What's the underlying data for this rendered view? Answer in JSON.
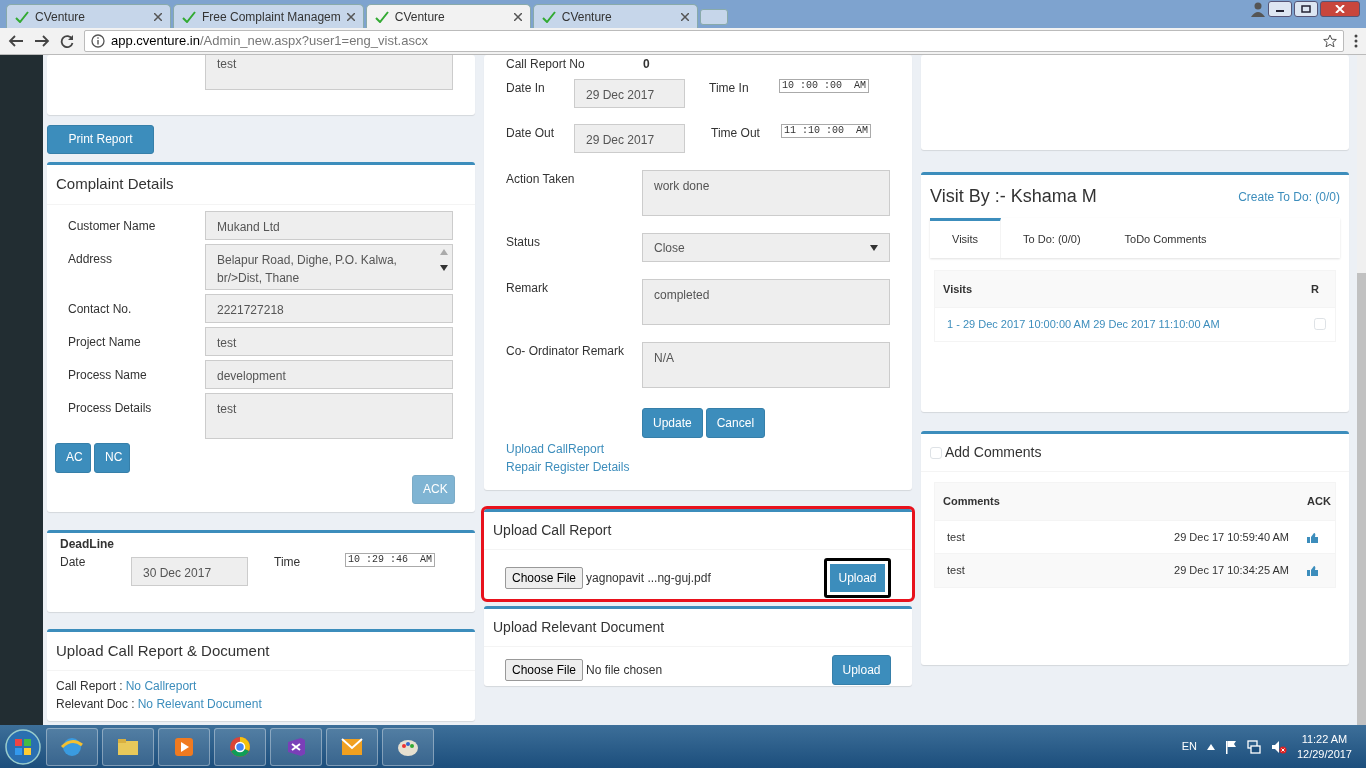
{
  "browser": {
    "tabs": [
      {
        "title": "CVenture",
        "selected": false
      },
      {
        "title": "Free Complaint Managem",
        "selected": false
      },
      {
        "title": "CVenture",
        "selected": true
      },
      {
        "title": "CVenture",
        "selected": false
      }
    ],
    "url_host": "app.cventure.in",
    "url_path": "/Admin_new.aspx?user1=eng_vist.ascx"
  },
  "left": {
    "top_card": {
      "value": "test"
    },
    "print_button": "Print Report",
    "complaint": {
      "title": "Complaint Details",
      "fields": [
        {
          "label": "Customer Name",
          "value": "Mukand Ltd",
          "kind": "input"
        },
        {
          "label": "Address",
          "value": "Belapur Road, Dighe, P.O. Kalwa,\nbr/>Dist, Thane",
          "kind": "scroll"
        },
        {
          "label": "Contact No.",
          "value": "2221727218",
          "kind": "input"
        },
        {
          "label": "Project Name",
          "value": "test",
          "kind": "input"
        },
        {
          "label": "Process Name",
          "value": "development",
          "kind": "input"
        },
        {
          "label": "Process Details",
          "value": "test",
          "kind": "textarea"
        }
      ],
      "buttons": [
        "AC",
        "NC"
      ],
      "ack": {
        "label": "ACK",
        "disabled": true
      }
    },
    "deadline": {
      "title": "DeadLine",
      "date_label": "Date",
      "date": "30 Dec 2017",
      "time_label": "Time",
      "time": "10 :29 :46  AM"
    },
    "upload_summary": {
      "title": "Upload Call Report & Document",
      "rows": [
        {
          "label": "Call Report :",
          "link": "No Callreport"
        },
        {
          "label": "Relevant Doc :",
          "link": "No Relevant Document"
        }
      ]
    }
  },
  "middle": {
    "call_report_no": {
      "label": "Call Report No",
      "value": "0"
    },
    "date_in": {
      "label": "Date In",
      "value": "29 Dec 2017",
      "time_label": "Time In",
      "time": "10 :00 :00  AM"
    },
    "date_out": {
      "label": "Date Out",
      "value": "29 Dec 2017",
      "time_label": "Time Out",
      "time": "11 :10 :00  AM"
    },
    "fields": [
      {
        "label": "Action Taken",
        "value": "work done",
        "kind": "textarea"
      },
      {
        "label": "Status",
        "value": "Close",
        "kind": "select"
      },
      {
        "label": "Remark",
        "value": "completed",
        "kind": "textarea"
      },
      {
        "label": "Co- Ordinator Remark",
        "value": "N/A",
        "kind": "textarea"
      }
    ],
    "buttons": [
      "Update",
      "Cancel"
    ],
    "links": [
      "Upload CallReport",
      "Repair Register Details"
    ],
    "uploads": [
      {
        "title": "Upload Call Report",
        "highlighted": true,
        "choose": "Choose File",
        "file": "yagnopavit ...ng-guj.pdf",
        "upload": "Upload",
        "upload_highlighted": true
      },
      {
        "title": "Upload Relevant Document",
        "highlighted": false,
        "choose": "Choose File",
        "file": "No file chosen",
        "upload": "Upload",
        "upload_highlighted": false
      }
    ]
  },
  "right": {
    "visit": {
      "title": "Visit By :- Kshama M",
      "create_link": "Create To Do: (0/0)",
      "tabs": [
        {
          "label": "Visits",
          "selected": true
        },
        {
          "label": "To Do: (0/0)",
          "selected": false
        },
        {
          "label": "ToDo Comments",
          "selected": false
        }
      ],
      "columns": [
        "Visits",
        "R"
      ],
      "rows": [
        {
          "text": "1 - 29 Dec 2017 10:00:00 AM 29 Dec 2017 11:10:00 AM",
          "checked": false
        }
      ]
    },
    "comments": {
      "title": "Add Comments",
      "checked": false,
      "columns": [
        "Comments",
        "ACK"
      ],
      "rows": [
        {
          "text": "test",
          "time": "29 Dec 17 10:59:40 AM"
        },
        {
          "text": "test",
          "time": "29 Dec 17 10:34:25 AM"
        }
      ]
    }
  },
  "taskbar": {
    "language": "EN",
    "time": "11:22 AM",
    "date": "12/29/2017"
  }
}
